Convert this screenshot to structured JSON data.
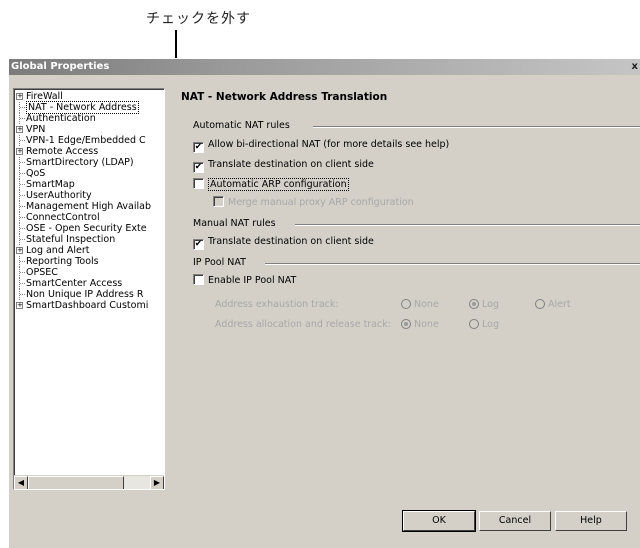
{
  "callout": {
    "text": "チェックを外す"
  },
  "dialog": {
    "title": "Global Properties",
    "close_label": "x"
  },
  "tree": {
    "items": [
      {
        "label": "FireWall",
        "expander": "+"
      },
      {
        "label": "NAT - Network Address",
        "selected": true
      },
      {
        "label": "Authentication"
      },
      {
        "label": "VPN",
        "expander": "+"
      },
      {
        "label": "VPN-1 Edge/Embedded C"
      },
      {
        "label": "Remote Access",
        "expander": "+"
      },
      {
        "label": "SmartDirectory (LDAP)"
      },
      {
        "label": "QoS"
      },
      {
        "label": "SmartMap"
      },
      {
        "label": "UserAuthority"
      },
      {
        "label": "Management High Availab"
      },
      {
        "label": "ConnectControl"
      },
      {
        "label": "OSE - Open Security Exte"
      },
      {
        "label": "Stateful Inspection"
      },
      {
        "label": "Log and Alert",
        "expander": "+"
      },
      {
        "label": "Reporting Tools"
      },
      {
        "label": "OPSEC"
      },
      {
        "label": "SmartCenter Access"
      },
      {
        "label": "Non Unique IP Address R"
      },
      {
        "label": "SmartDashboard Customi",
        "expander": "+"
      }
    ],
    "scroll_left": "◀",
    "scroll_right": "▶"
  },
  "panel": {
    "title": "NAT - Network Address Translation",
    "automatic": {
      "header": "Automatic NAT rules",
      "allow_bidirectional": {
        "label": "Allow bi-directional NAT  (for more details see help)",
        "checked": true
      },
      "translate_client": {
        "label": "Translate destination on client side",
        "checked": true
      },
      "automatic_arp": {
        "label": "Automatic ARP configuration",
        "checked": false
      },
      "merge_proxy_arp": {
        "label": "Merge manual proxy ARP configuration",
        "checked": false
      }
    },
    "manual": {
      "header": "Manual NAT rules",
      "translate_client": {
        "label": "Translate destination on client side",
        "checked": true
      }
    },
    "ip_pool": {
      "header": "IP Pool NAT",
      "enable": {
        "label": "Enable IP Pool NAT",
        "checked": false
      },
      "exhaustion_label": "Address exhaustion track:",
      "exhaustion_options": [
        "None",
        "Log",
        "Alert"
      ],
      "exhaustion_selected": "Log",
      "allocation_label": "Address allocation and release track:",
      "allocation_options": [
        "None",
        "Log"
      ],
      "allocation_selected": "None"
    }
  },
  "buttons": {
    "ok": "OK",
    "cancel": "Cancel",
    "help": "Help"
  }
}
